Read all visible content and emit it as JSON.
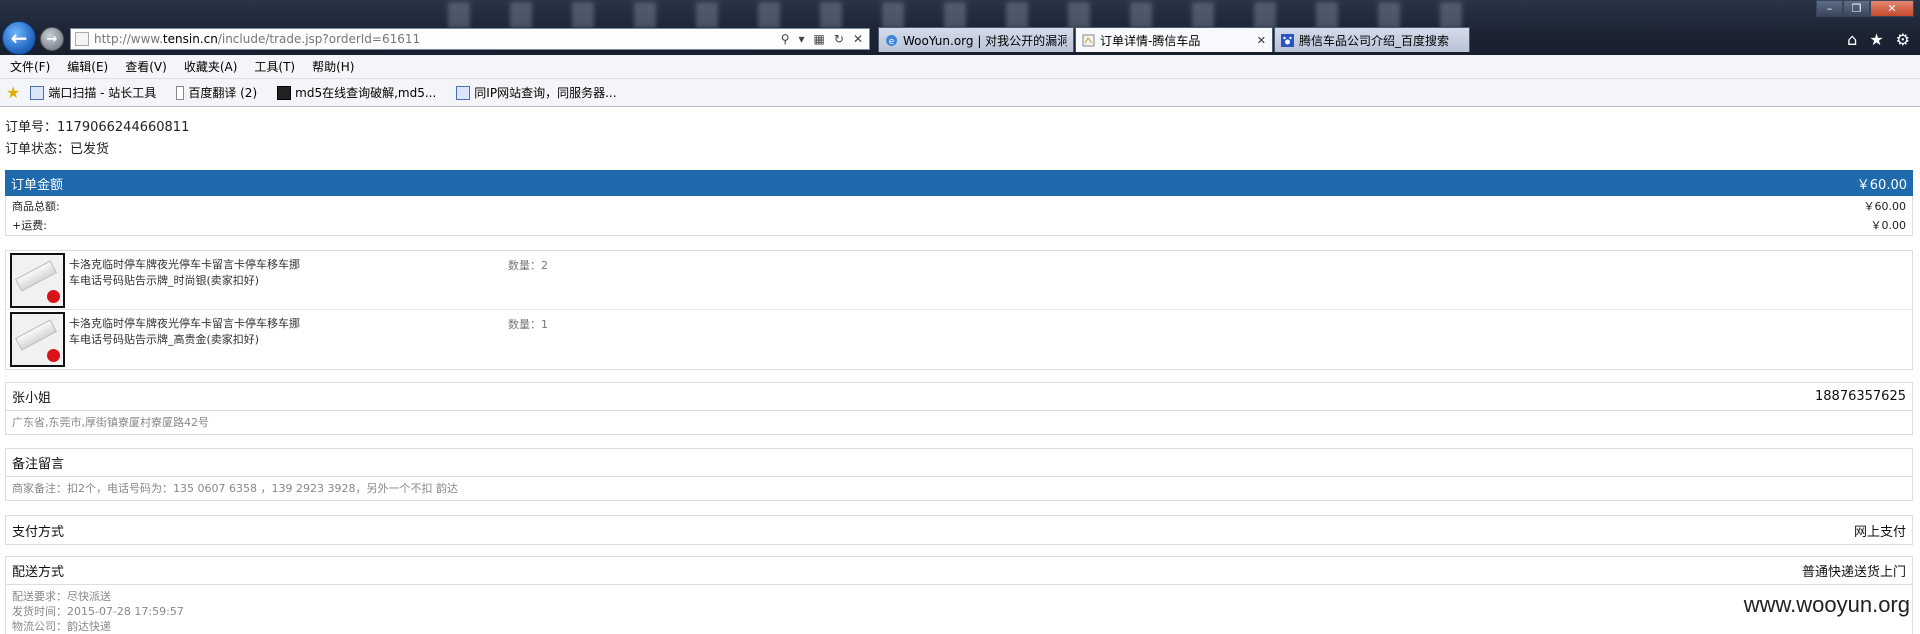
{
  "browser": {
    "url_prefix": "http://www.",
    "url_domain": "tensin.cn",
    "url_path": "/include/trade.jsp?orderId=61611",
    "tabs": [
      {
        "title": "WooYun.org | 对我公开的漏洞"
      },
      {
        "title": "订单详情-腾信车品"
      },
      {
        "title": "腾信车品公司介绍_百度搜索"
      }
    ],
    "menu": [
      "文件(F)",
      "编辑(E)",
      "查看(V)",
      "收藏夹(A)",
      "工具(T)",
      "帮助(H)"
    ],
    "favorites": [
      "端口扫描 - 站长工具",
      "百度翻译 (2)",
      "md5在线查询破解,md5...",
      "同IP网站查询，同服务器..."
    ]
  },
  "order": {
    "number_line": "订单号：1179066244660811",
    "status_line": "订单状态：已发货"
  },
  "amount": {
    "header_label": "订单金额",
    "header_value": "￥60.00",
    "rows": [
      {
        "label": "商品总额:",
        "value": "￥60.00"
      },
      {
        "label": "+运费:",
        "value": "￥0.00"
      }
    ]
  },
  "products": [
    {
      "name": "卡洛克临时停车牌夜光停车卡留言卡停车移车挪车电话号码贴告示牌_时尚银(卖家扣好)",
      "qty": "数量：2"
    },
    {
      "name": "卡洛克临时停车牌夜光停车卡留言卡停车移车挪车电话号码贴告示牌_高贵金(卖家扣好)",
      "qty": "数量：1"
    }
  ],
  "recipient": {
    "name": "张小姐",
    "phone": "18876357625",
    "address": "广东省,东莞市,厚街镇寮厦村寮厦路42号"
  },
  "remark": {
    "title": "备注留言",
    "text": "商家备注：扣2个，电话号码为：135 0607 6358 ，139 2923 3928，另外一个不扣 韵达"
  },
  "payment": {
    "title": "支付方式",
    "value": "网上支付"
  },
  "delivery": {
    "title": "配送方式",
    "value": "普通快递送货上门",
    "lines": [
      "配送要求：尽快派送",
      "发货时间：2015-07-28 17:59:57",
      "物流公司：韵达快递"
    ]
  },
  "watermark": "www.wooyun.org"
}
